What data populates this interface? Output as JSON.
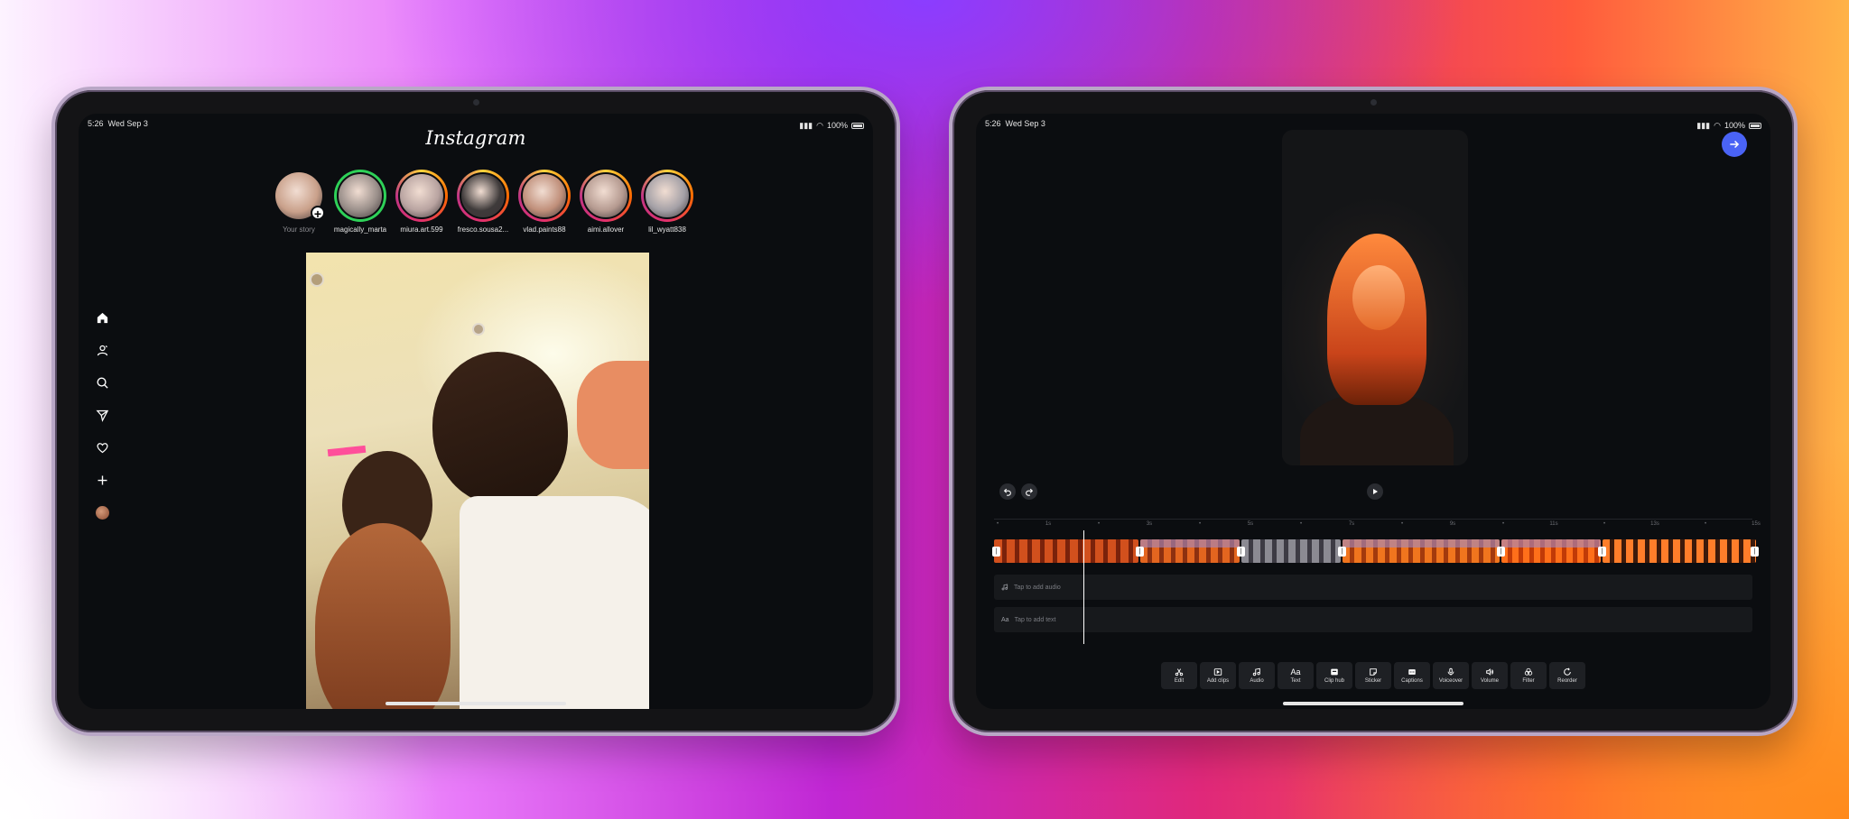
{
  "status_bar": {
    "time": "5:26",
    "date": "Wed Sep 3",
    "battery": "100%"
  },
  "instagram": {
    "logo": "Instagram",
    "stories": [
      {
        "label": "Your story",
        "own": true,
        "ring": "none",
        "avatar": "#c9a08a"
      },
      {
        "label": "magically_marta",
        "own": false,
        "ring": "green",
        "avatar": "#9a8f8a"
      },
      {
        "label": "miura.art.599",
        "own": false,
        "ring": "gradient",
        "avatar": "#b8a3a0"
      },
      {
        "label": "fresco.sousa2...",
        "own": false,
        "ring": "gradient",
        "avatar": "#3e3a3a"
      },
      {
        "label": "vlad.paints88",
        "own": false,
        "ring": "gradient",
        "avatar": "#c08f7a"
      },
      {
        "label": "aimi.allover",
        "own": false,
        "ring": "gradient",
        "avatar": "#b59a90"
      },
      {
        "label": "lil_wyatt838",
        "own": false,
        "ring": "gradient",
        "avatar": "#a4a0a6"
      }
    ],
    "sidebar_icons": [
      "home-icon",
      "people-icon",
      "search-icon",
      "send-icon",
      "heart-icon",
      "plus-icon",
      "profile-avatar"
    ]
  },
  "editor": {
    "ruler_ticks": [
      "•",
      "1s",
      "•",
      "3s",
      "•",
      "5s",
      "•",
      "7s",
      "•",
      "9s",
      "•",
      "11s",
      "•",
      "13s",
      "•",
      "15s"
    ],
    "audio_track_label": "Tap to add audio",
    "text_track_label": "Tap to add text",
    "tools": [
      {
        "label": "Edit",
        "icon": "scissors-icon"
      },
      {
        "label": "Add clips",
        "icon": "add-clip-icon"
      },
      {
        "label": "Audio",
        "icon": "music-note-icon"
      },
      {
        "label": "Text",
        "icon": "text-icon"
      },
      {
        "label": "Clip hub",
        "icon": "clip-hub-icon"
      },
      {
        "label": "Sticker",
        "icon": "sticker-icon"
      },
      {
        "label": "Captions",
        "icon": "captions-icon"
      },
      {
        "label": "Voiceover",
        "icon": "microphone-icon"
      },
      {
        "label": "Volume",
        "icon": "speaker-icon"
      },
      {
        "label": "Filter",
        "icon": "filter-icon"
      },
      {
        "label": "Reorder",
        "icon": "reorder-icon"
      }
    ]
  },
  "colors": {
    "accent": "#4a63f5",
    "screen_bg": "#0b0d10",
    "ring_green": "#2ed158"
  }
}
